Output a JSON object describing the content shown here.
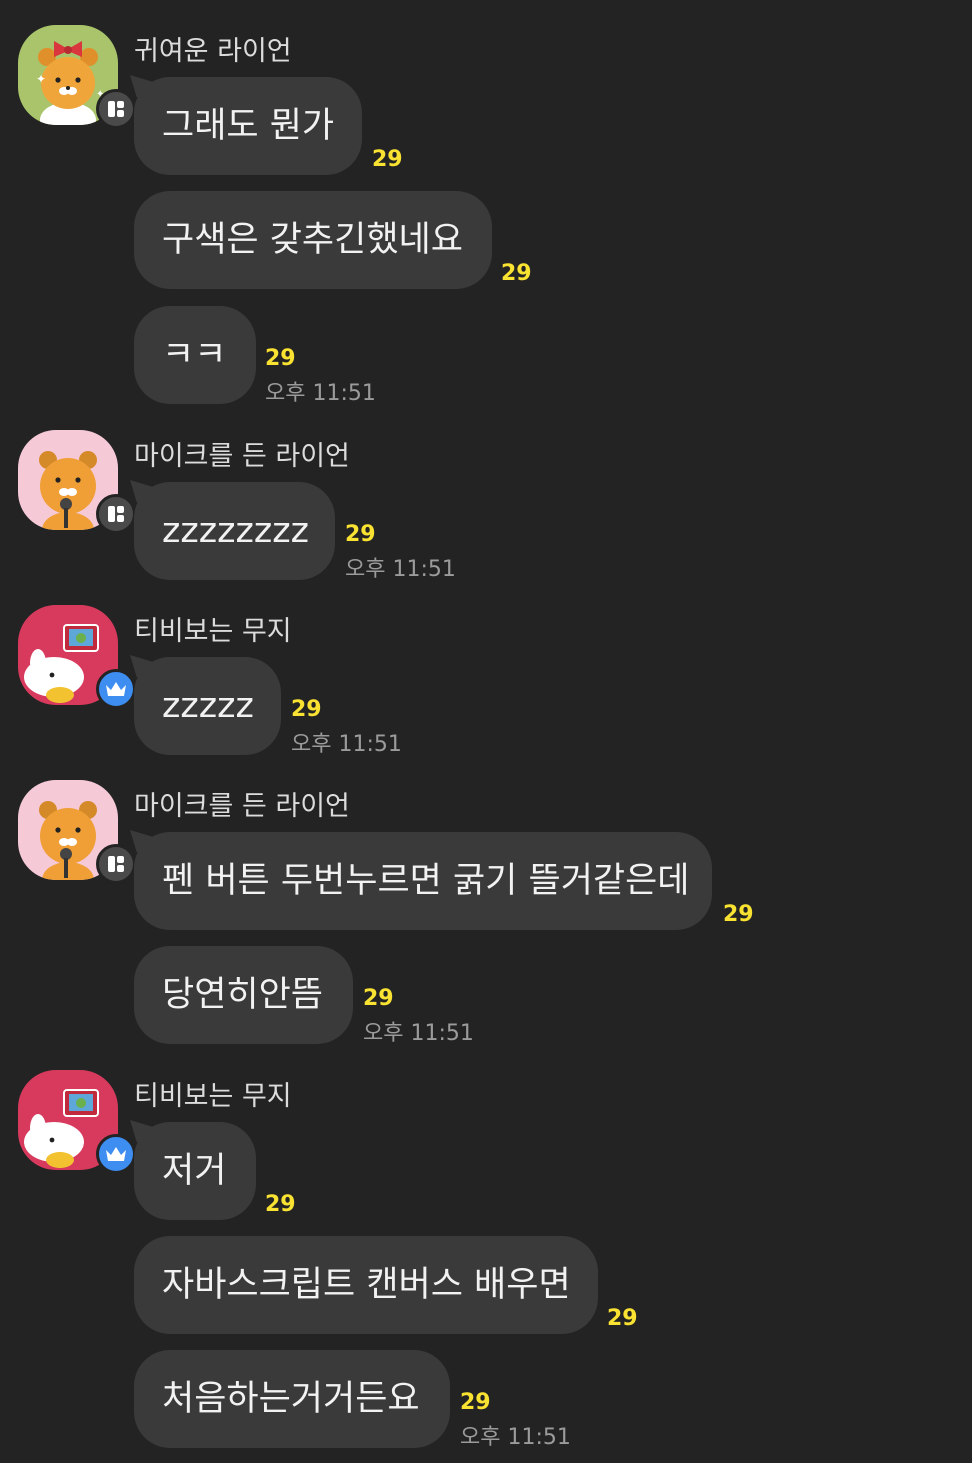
{
  "colors": {
    "background": "#232323",
    "bubble": "#3a3a3a",
    "unread": "#f9e231",
    "time": "#9b9b9b"
  },
  "groups": [
    {
      "sender": "귀여운 라이언",
      "avatar_icon": "ryan-ribbon-avatar-icon",
      "badge_icon": "manager-badge-icon",
      "messages": [
        {
          "text": "그래도 뭔가",
          "count": "29",
          "time": ""
        },
        {
          "text": "구색은 갖추긴했네요",
          "count": "29",
          "time": ""
        },
        {
          "text": "ㅋㅋ",
          "count": "29",
          "time": "오후 11:51"
        }
      ]
    },
    {
      "sender": "마이크를 든 라이언",
      "avatar_icon": "ryan-microphone-avatar-icon",
      "badge_icon": "manager-badge-icon",
      "messages": [
        {
          "text": "zzzzzzzz",
          "count": "29",
          "time": "오후 11:51"
        }
      ]
    },
    {
      "sender": "티비보는 무지",
      "avatar_icon": "muzi-tv-avatar-icon",
      "badge_icon": "owner-crown-badge-icon",
      "messages": [
        {
          "text": "zzzzz",
          "count": "29",
          "time": "오후 11:51"
        }
      ]
    },
    {
      "sender": "마이크를 든 라이언",
      "avatar_icon": "ryan-microphone-avatar-icon",
      "badge_icon": "manager-badge-icon",
      "messages": [
        {
          "text": "펜 버튼 두번누르면 굵기 뜰거같은데",
          "count": "29",
          "time": ""
        },
        {
          "text": "당연히안뜸",
          "count": "29",
          "time": "오후 11:51"
        }
      ]
    },
    {
      "sender": "티비보는 무지",
      "avatar_icon": "muzi-tv-avatar-icon",
      "badge_icon": "owner-crown-badge-icon",
      "messages": [
        {
          "text": "저거",
          "count": "29",
          "time": ""
        },
        {
          "text": "자바스크립트 캔버스 배우면",
          "count": "29",
          "time": ""
        },
        {
          "text": "처음하는거거든요",
          "count": "29",
          "time": "오후 11:51"
        }
      ]
    }
  ]
}
